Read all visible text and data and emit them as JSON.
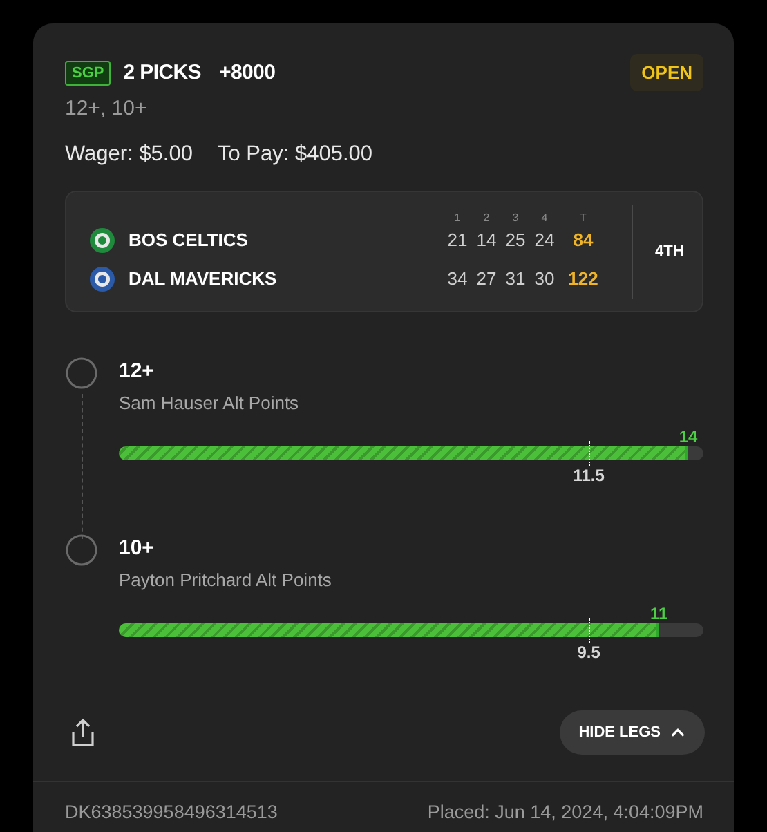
{
  "bet": {
    "badge": "SGP",
    "title": "2 PICKS",
    "odds": "+8000",
    "status": "OPEN",
    "summary": "12+, 10+",
    "wager": "Wager: $5.00",
    "to_pay": "To Pay: $405.00"
  },
  "scoreboard": {
    "periods": [
      "1",
      "2",
      "3",
      "4",
      "T"
    ],
    "period_status": "4TH",
    "teams": [
      {
        "name": "BOS CELTICS",
        "color": "#1f8a3c",
        "scores": [
          "21",
          "14",
          "25",
          "24"
        ],
        "total": "84"
      },
      {
        "name": "DAL MAVERICKS",
        "color": "#2a5aa8",
        "scores": [
          "34",
          "27",
          "31",
          "30"
        ],
        "total": "122"
      }
    ]
  },
  "legs": [
    {
      "pick": "12+",
      "market": "Sam Hauser Alt Points",
      "result": {
        "label": "14",
        "level": 0.974
      },
      "line": {
        "label": "11.5",
        "level": 0.804
      }
    },
    {
      "pick": "10+",
      "market": "Payton Pritchard Alt Points",
      "result": {
        "label": "11",
        "level": 0.924
      },
      "line": {
        "label": "9.5",
        "level": 0.804
      }
    }
  ],
  "hide_legs": "HIDE LEGS",
  "footer": {
    "id": "DK638539958496314513",
    "placed": "Placed: Jun 14, 2024, 4:04:09PM"
  }
}
